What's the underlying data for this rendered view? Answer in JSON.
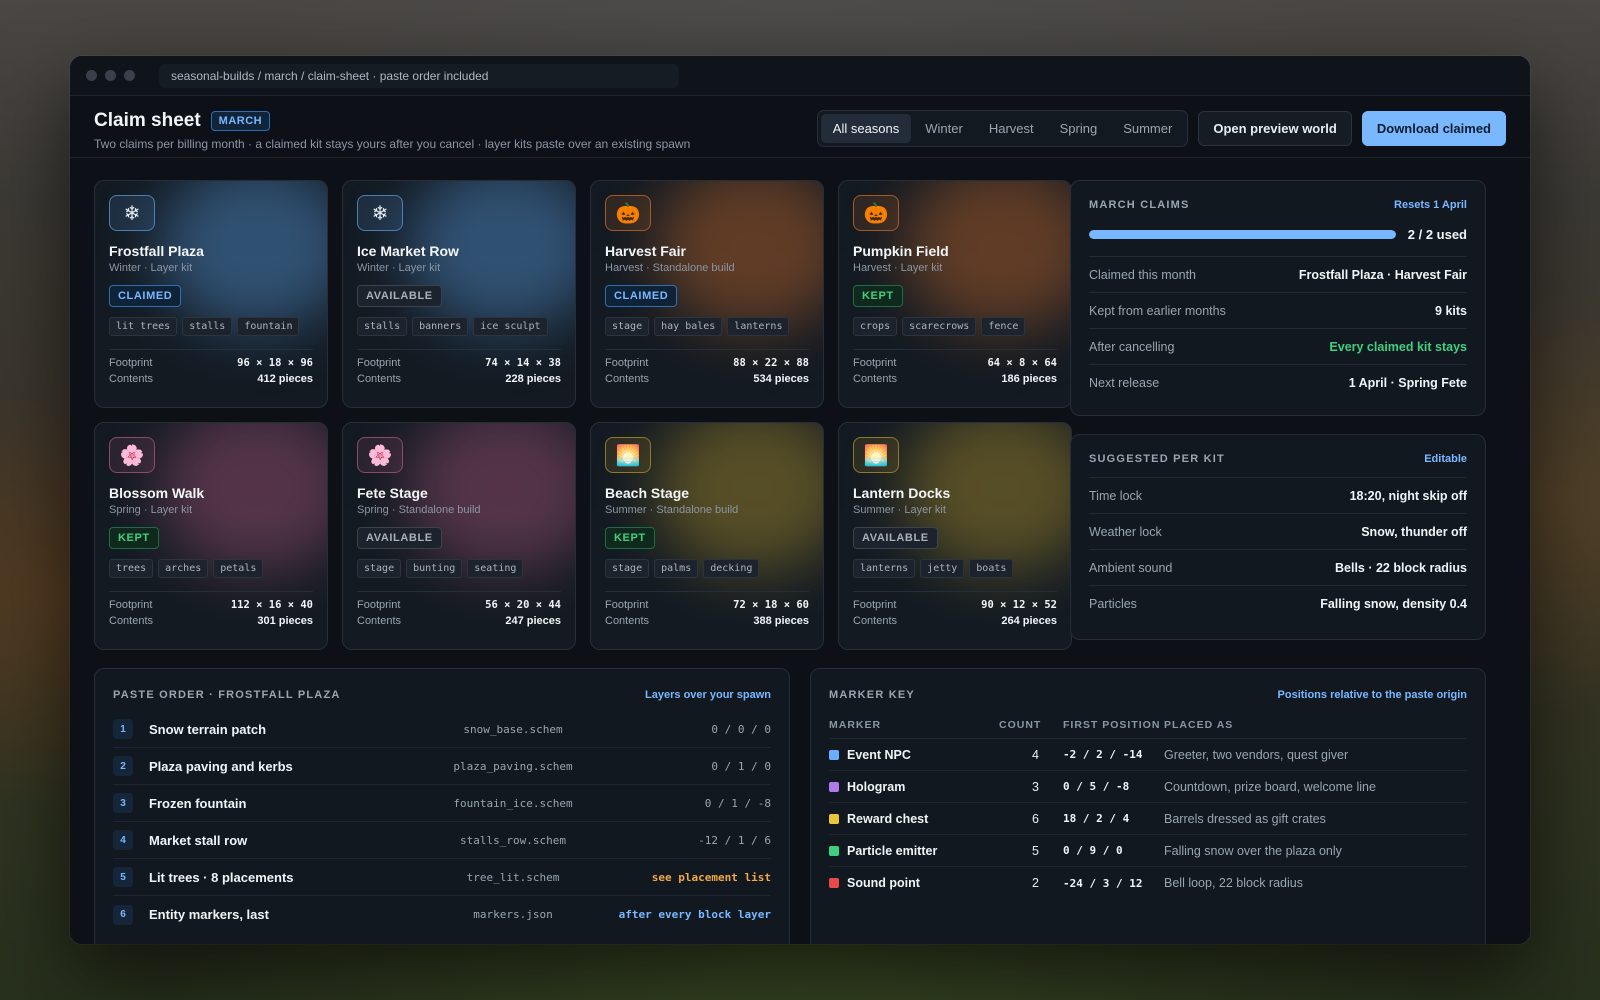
{
  "browser": {
    "address": "seasonal-builds / march / claim-sheet · paste order included"
  },
  "header": {
    "title": "Claim sheet",
    "month_badge": "MARCH",
    "subtitle": "Two claims per billing month · a claimed kit stays yours after you cancel · layer kits paste over an existing spawn",
    "filters": [
      "All seasons",
      "Winter",
      "Harvest",
      "Spring",
      "Summer"
    ],
    "active_filter": "All seasons",
    "preview_button": "Open preview world",
    "download_button": "Download claimed"
  },
  "kits": [
    {
      "name": "Frostfall Plaza",
      "meta": "Winter · Layer kit",
      "status": "CLAIMED",
      "status_kind": "claimed",
      "icon": "snowflake-icon",
      "glyph": "❄",
      "accent": "#4a7fb5",
      "tags": [
        "lit trees",
        "stalls",
        "fountain"
      ],
      "footprint": "96 × 18 × 96",
      "contents": "412 pieces"
    },
    {
      "name": "Ice Market Row",
      "meta": "Winter · Layer kit",
      "status": "AVAILABLE",
      "status_kind": "available",
      "icon": "snowflake-icon",
      "glyph": "❄",
      "accent": "#4a7fb5",
      "tags": [
        "stalls",
        "banners",
        "ice sculpt"
      ],
      "footprint": "74 × 14 × 38",
      "contents": "228 pieces"
    },
    {
      "name": "Harvest Fair",
      "meta": "Harvest · Standalone build",
      "status": "CLAIMED",
      "status_kind": "claimed",
      "icon": "pumpkin-icon",
      "glyph": "🎃",
      "accent": "#a0592a",
      "tags": [
        "stage",
        "hay bales",
        "lanterns"
      ],
      "footprint": "88 × 22 × 88",
      "contents": "534 pieces"
    },
    {
      "name": "Pumpkin Field",
      "meta": "Harvest · Layer kit",
      "status": "KEPT",
      "status_kind": "kept",
      "icon": "pumpkin-icon",
      "glyph": "🎃",
      "accent": "#a0592a",
      "tags": [
        "crops",
        "scarecrows",
        "fence"
      ],
      "footprint": "64 × 8 × 64",
      "contents": "186 pieces"
    },
    {
      "name": "Blossom Walk",
      "meta": "Spring · Layer kit",
      "status": "KEPT",
      "status_kind": "kept",
      "icon": "blossom-icon",
      "glyph": "🌸",
      "accent": "#8a4a6a",
      "tags": [
        "trees",
        "arches",
        "petals"
      ],
      "footprint": "112 × 16 × 40",
      "contents": "301 pieces"
    },
    {
      "name": "Fete Stage",
      "meta": "Spring · Standalone build",
      "status": "AVAILABLE",
      "status_kind": "available",
      "icon": "blossom-icon",
      "glyph": "🌸",
      "accent": "#8a4a6a",
      "tags": [
        "stage",
        "bunting",
        "seating"
      ],
      "footprint": "56 × 20 × 44",
      "contents": "247 pieces"
    },
    {
      "name": "Beach Stage",
      "meta": "Summer · Standalone build",
      "status": "KEPT",
      "status_kind": "kept",
      "icon": "sunset-icon",
      "glyph": "🌅",
      "accent": "#8f7a2a",
      "tags": [
        "stage",
        "palms",
        "decking"
      ],
      "footprint": "72 × 18 × 60",
      "contents": "388 pieces"
    },
    {
      "name": "Lantern Docks",
      "meta": "Summer · Layer kit",
      "status": "AVAILABLE",
      "status_kind": "available",
      "icon": "sunset-icon",
      "glyph": "🌅",
      "accent": "#8f7a2a",
      "tags": [
        "lanterns",
        "jetty",
        "boats"
      ],
      "footprint": "90 × 12 × 52",
      "contents": "264 pieces"
    }
  ],
  "card_labels": {
    "footprint": "Footprint",
    "contents": "Contents"
  },
  "claims_panel": {
    "title": "MARCH CLAIMS",
    "link": "Resets 1 April",
    "used": 2,
    "limit": 2,
    "used_label": "2 / 2 used",
    "rows": [
      {
        "k": "Claimed this month",
        "v": "Frostfall Plaza · Harvest Fair",
        "tone": ""
      },
      {
        "k": "Kept from earlier months",
        "v": "9 kits",
        "tone": ""
      },
      {
        "k": "After cancelling",
        "v": "Every claimed kit stays",
        "tone": "green"
      },
      {
        "k": "Next release",
        "v": "1 April · Spring Fete",
        "tone": ""
      }
    ]
  },
  "suggested_panel": {
    "title": "SUGGESTED PER KIT",
    "link": "Editable",
    "rows": [
      {
        "k": "Time lock",
        "v": "18:20, night skip off"
      },
      {
        "k": "Weather lock",
        "v": "Snow, thunder off"
      },
      {
        "k": "Ambient sound",
        "v": "Bells · 22 block radius"
      },
      {
        "k": "Particles",
        "v": "Falling snow, density 0.4"
      }
    ]
  },
  "paste_order": {
    "title": "PASTE ORDER · FROSTFALL PLAZA",
    "link": "Layers over your spawn",
    "steps": [
      {
        "n": "1",
        "name": "Snow terrain patch",
        "file": "snow_base.schem",
        "pos": "0 / 0 / 0",
        "tone": ""
      },
      {
        "n": "2",
        "name": "Plaza paving and kerbs",
        "file": "plaza_paving.schem",
        "pos": "0 / 1 / 0",
        "tone": ""
      },
      {
        "n": "3",
        "name": "Frozen fountain",
        "file": "fountain_ice.schem",
        "pos": "0 / 1 / -8",
        "tone": ""
      },
      {
        "n": "4",
        "name": "Market stall row",
        "file": "stalls_row.schem",
        "pos": "-12 / 1 / 6",
        "tone": ""
      },
      {
        "n": "5",
        "name": "Lit trees · 8 placements",
        "file": "tree_lit.schem",
        "pos": "see placement list",
        "tone": "orange"
      },
      {
        "n": "6",
        "name": "Entity markers, last",
        "file": "markers.json",
        "pos": "after every block layer",
        "tone": "blue"
      }
    ]
  },
  "marker_key": {
    "title": "MARKER KEY",
    "link": "Positions relative to the paste origin",
    "columns": [
      "MARKER",
      "COUNT",
      "FIRST POSITION",
      "PLACED AS"
    ],
    "rows": [
      {
        "name": "Event NPC",
        "color": "#6aaeff",
        "count": "4",
        "pos": "-2 / 2 / -14",
        "placed": "Greeter, two vendors, quest giver"
      },
      {
        "name": "Hologram",
        "color": "#b07ae8",
        "count": "3",
        "pos": "0 / 5 / -8",
        "placed": "Countdown, prize board, welcome line"
      },
      {
        "name": "Reward chest",
        "color": "#e8c640",
        "count": "6",
        "pos": "18 / 2 / 4",
        "placed": "Barrels dressed as gift crates"
      },
      {
        "name": "Particle emitter",
        "color": "#3fcf7f",
        "count": "5",
        "pos": "0 / 9 / 0",
        "placed": "Falling snow over the plaza only"
      },
      {
        "name": "Sound point",
        "color": "#e84a4a",
        "count": "2",
        "pos": "-24 / 3 / 12",
        "placed": "Bell loop, 22 block radius"
      }
    ]
  }
}
